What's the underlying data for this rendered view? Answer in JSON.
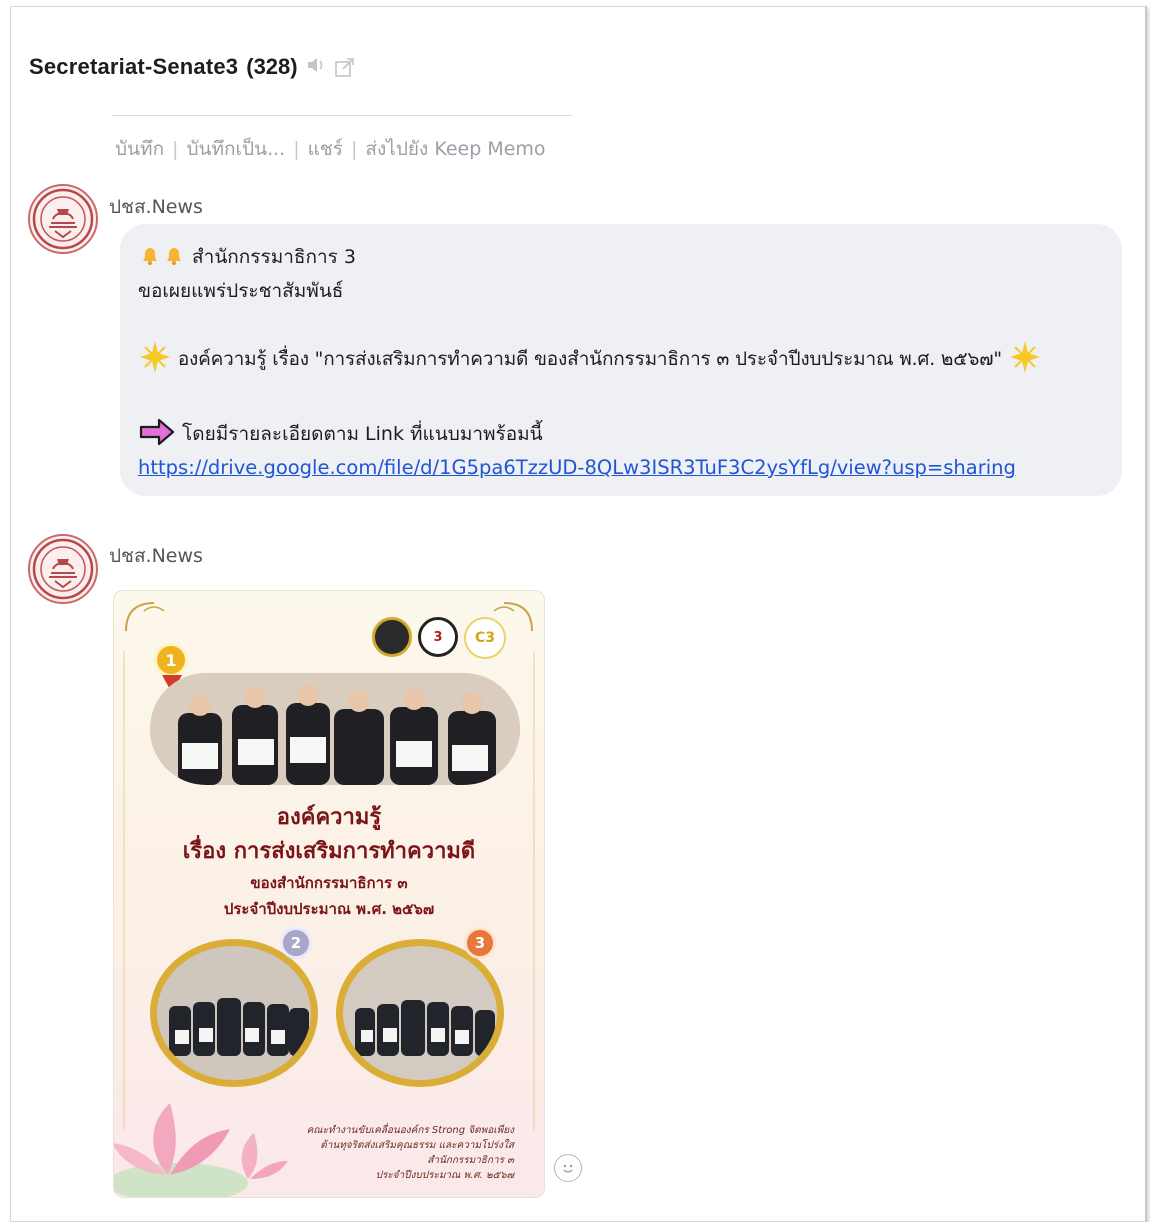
{
  "chat": {
    "room_name": "Secretariat-Senate3",
    "member_count": "(328)",
    "mute_icon": "speaker-icon",
    "popout_icon": "popout-icon"
  },
  "prev_message_actions": {
    "items": [
      "บันทึก",
      "บันทึกเป็น...",
      "แชร์",
      "ส่งไปยัง Keep Memo"
    ],
    "separator": "|"
  },
  "messages": [
    {
      "sender": "ปชส.News",
      "lines": [
        "สำนักกรรมาธิการ 3",
        "ขอเผยแพร่ประชาสัมพันธ์",
        "องค์ความรู้ เรื่อง \"การส่งเสริมการทำความดี ของสำนักกรรมาธิการ ๓ ประจำปีงบประมาณ พ.ศ. ๒๕๖๗\"",
        "โดยมีรายละเอียดตาม Link ที่แนบมาพร้อมนี้"
      ],
      "link": "https://drive.google.com/file/d/1G5pa6TzzUD-8QLw3ISR3TuF3C2ysYfLg/view?usp=sharing"
    },
    {
      "sender": "ปชส.News",
      "poster": {
        "title": "องค์ความรู้",
        "subtitle": "เรื่อง การส่งเสริมการทำความดี",
        "line3": "ของสำนักกรรมาธิการ ๓",
        "line4": "ประจำปีงบประมาณ พ.ศ. ๒๕๖๗",
        "badges": [
          "1",
          "2",
          "3"
        ],
        "logo_3": "3",
        "logo_c3": "C3",
        "footer": [
          "คณะทำงานขับเคลื่อนองค์กร Strong จิตพอเพียง",
          "ต้านทุจริตส่งเสริมคุณธรรม และความโปร่งใส",
          "สำนักกรรมาธิการ ๓",
          "ประจำปีงบประมาณ พ.ศ. ๒๕๖๗"
        ]
      }
    }
  ],
  "icons": {
    "bell": "bell-icon",
    "sparkle": "sparkle-icon",
    "arrow": "arrow-right-icon",
    "reaction": "smiley-icon"
  },
  "colors": {
    "link": "#1f55d6",
    "bubble_bg": "#eef0f3",
    "poster_title": "#7a1419"
  }
}
